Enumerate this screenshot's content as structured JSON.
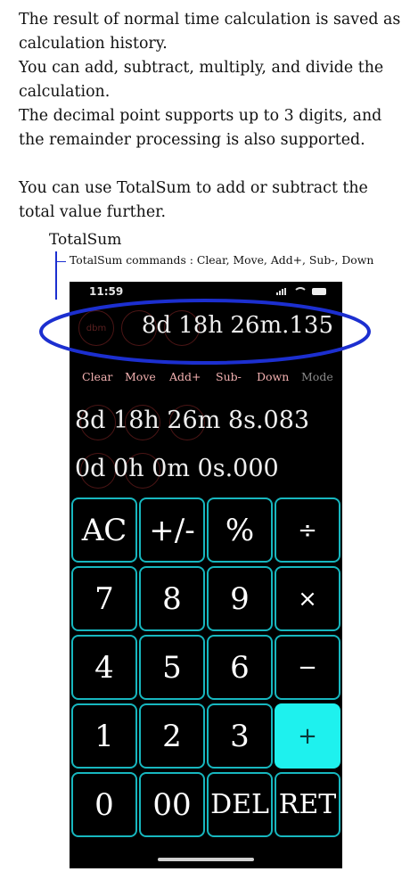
{
  "intro": {
    "lines": [
      "The result of normal time calculation is saved as",
      "calculation history.",
      "You can add, subtract, multiply, and divide the",
      "calculation.",
      "The decimal point supports up to 3 digits, and",
      "the remainder processing is also supported.",
      "You can use TotalSum to add or subtract the",
      "total value further."
    ]
  },
  "callout": {
    "title": "TotalSum",
    "commands": "TotalSum commands : Clear, Move, Add+, Sub-, Down"
  },
  "phone": {
    "status_time": "11:59",
    "circle_label": "dbm",
    "display_value": "8d 18h 26m.135",
    "commands": [
      "Clear",
      "Move",
      "Add+",
      "Sub-",
      "Down",
      "Mode"
    ],
    "total_1": "8d 18h 26m 8s.083",
    "total_2": "0d 0h 0m 0s.000",
    "keys": [
      [
        "AC",
        "+/-",
        "%",
        "÷"
      ],
      [
        "7",
        "8",
        "9",
        "×"
      ],
      [
        "4",
        "5",
        "6",
        "−"
      ],
      [
        "1",
        "2",
        "3",
        "+"
      ],
      [
        "0",
        "00",
        "DEL",
        "RET"
      ]
    ]
  },
  "colors": {
    "accent_cyan": "#1ef1ee",
    "key_border": "#17b7bf",
    "command_text": "#f3b1b1",
    "highlight_ellipse": "#1c2fd0"
  }
}
